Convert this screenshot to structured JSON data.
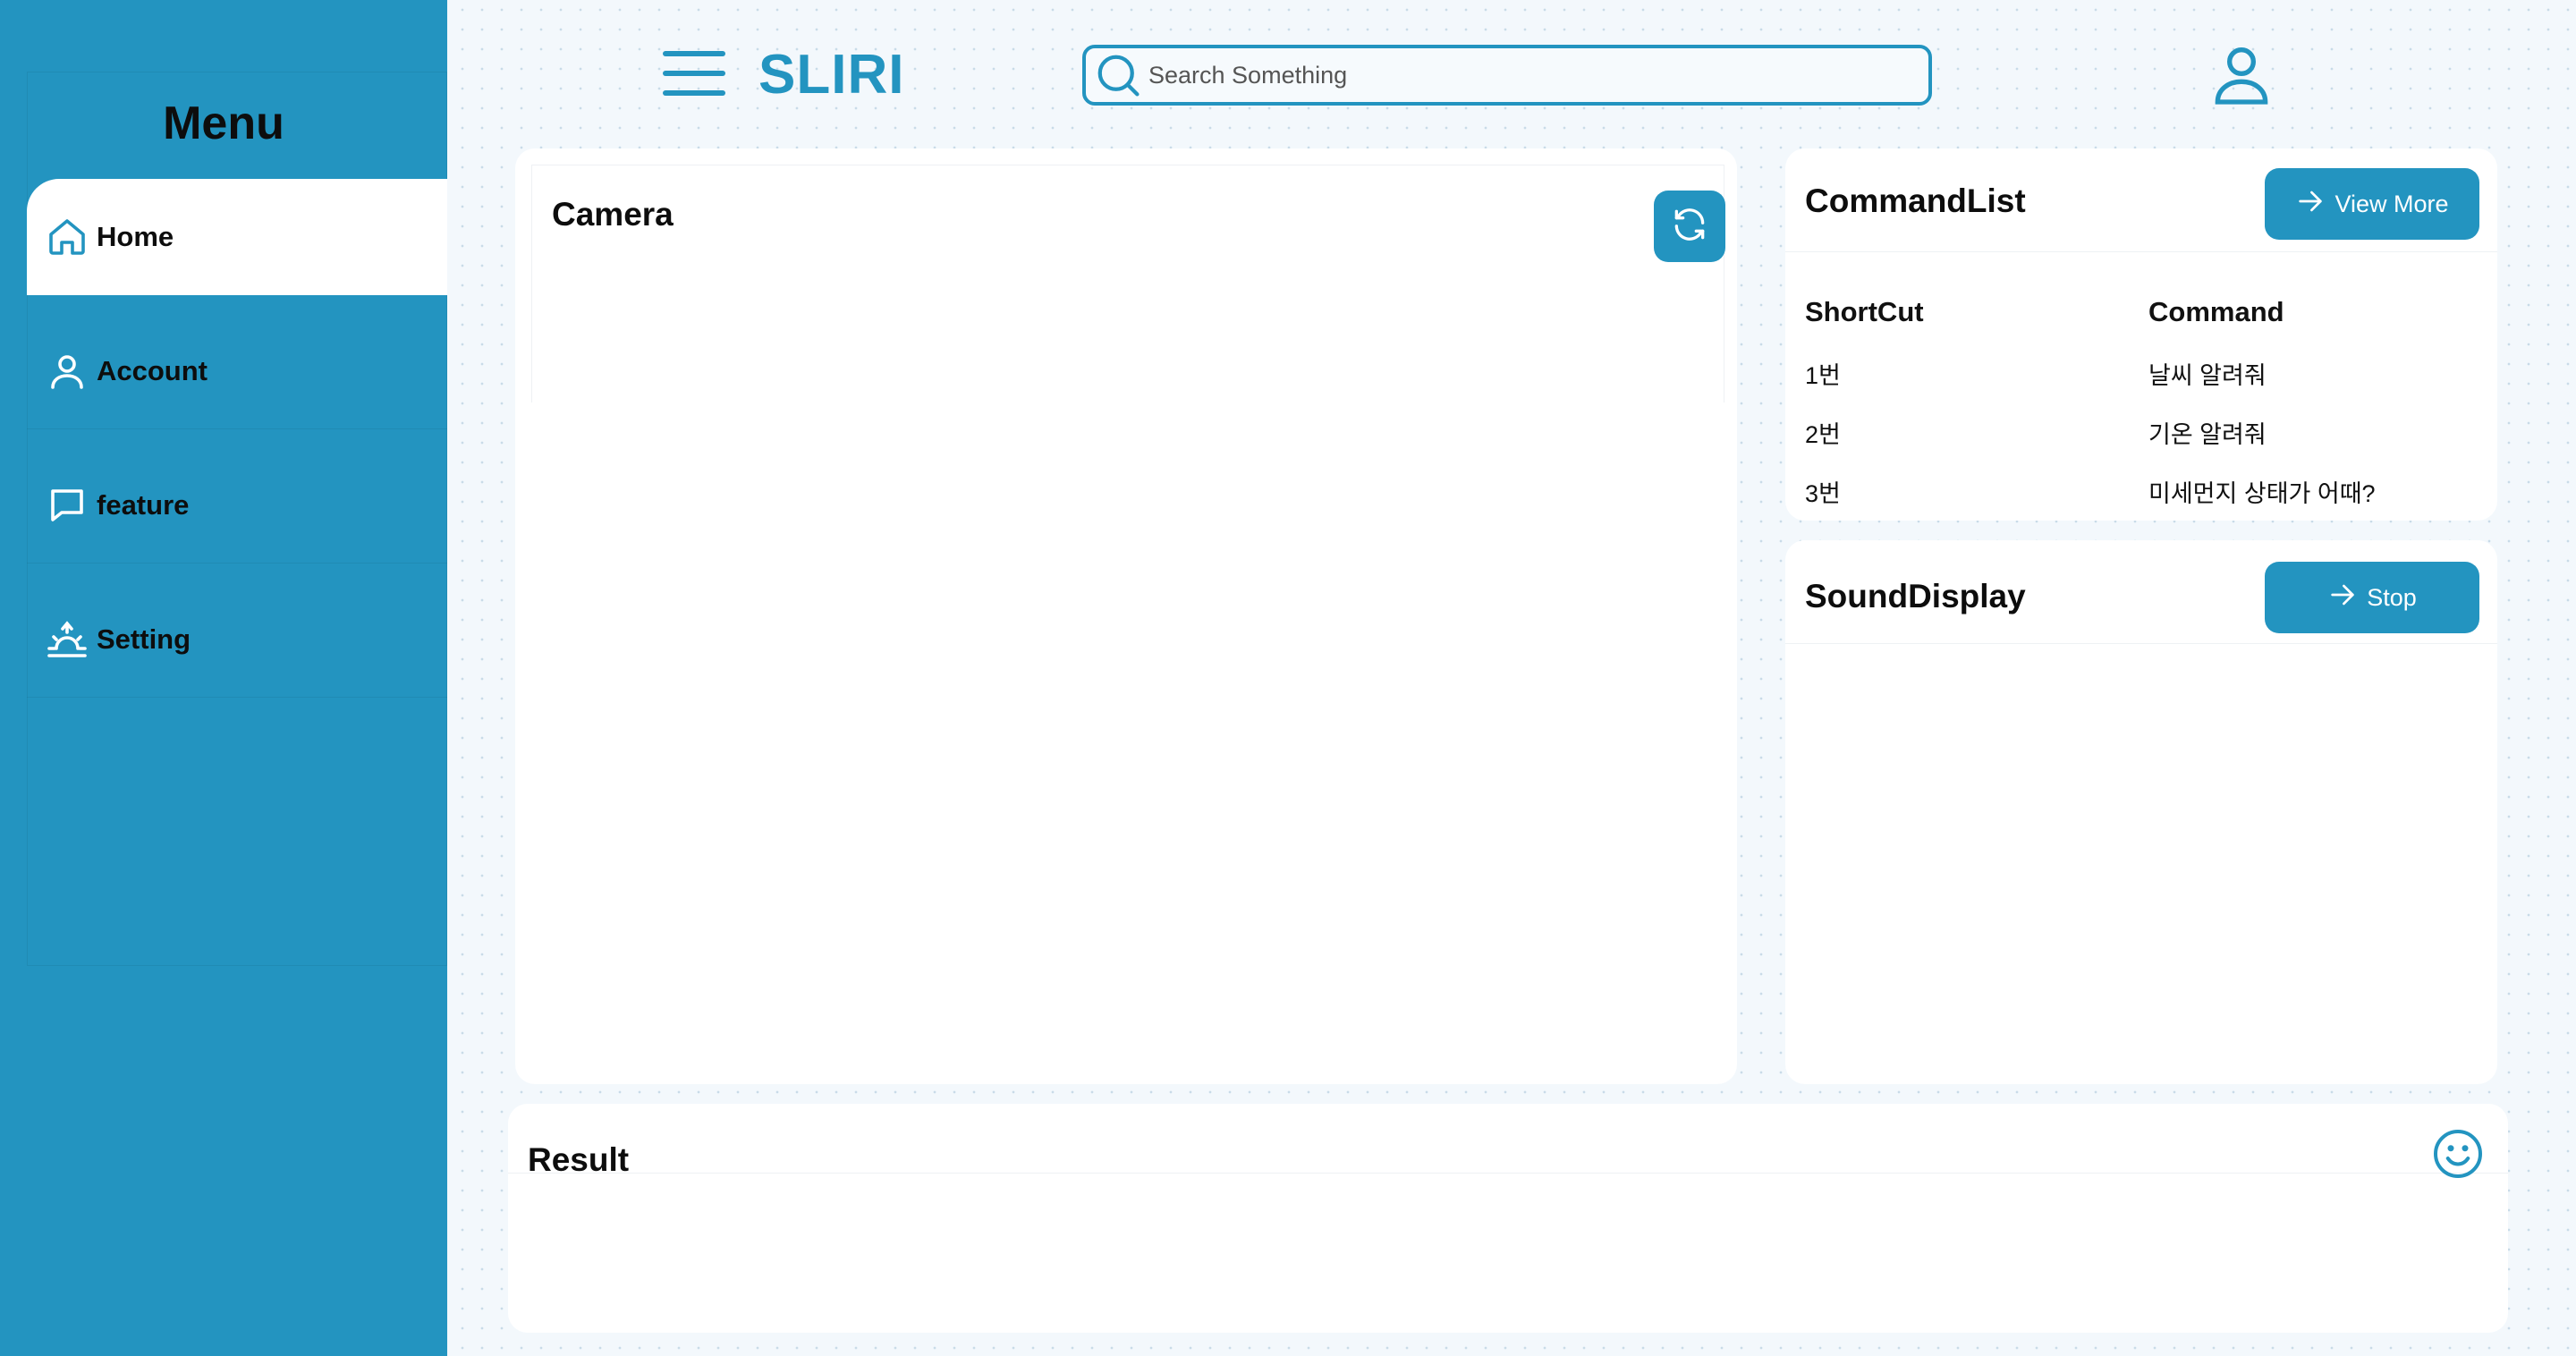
{
  "sidebar": {
    "title": "Menu",
    "items": [
      {
        "label": "Home",
        "icon": "home-icon",
        "active": true
      },
      {
        "label": "Account",
        "icon": "user-icon",
        "active": false
      },
      {
        "label": "feature",
        "icon": "chat-icon",
        "active": false
      },
      {
        "label": "Setting",
        "icon": "sunrise-icon",
        "active": false
      }
    ]
  },
  "header": {
    "brand": "SLIRI",
    "search_placeholder": "Search Something"
  },
  "camera": {
    "title": "Camera"
  },
  "command_list": {
    "title": "CommandList",
    "view_more_label": "View More",
    "columns": [
      "ShortCut",
      "Command"
    ],
    "rows": [
      [
        "1번",
        "날씨 알려줘"
      ],
      [
        "2번",
        "기온 알려줘"
      ],
      [
        "3번",
        "미세먼지 상태가 어때?"
      ]
    ]
  },
  "sound_display": {
    "title": "SoundDisplay",
    "stop_label": "Stop"
  },
  "result": {
    "title": "Result"
  },
  "colors": {
    "accent": "#2394c0",
    "sidebar_bg": "#2394c0",
    "card_bg": "#ffffff",
    "page_bg": "#f3f8fc"
  }
}
